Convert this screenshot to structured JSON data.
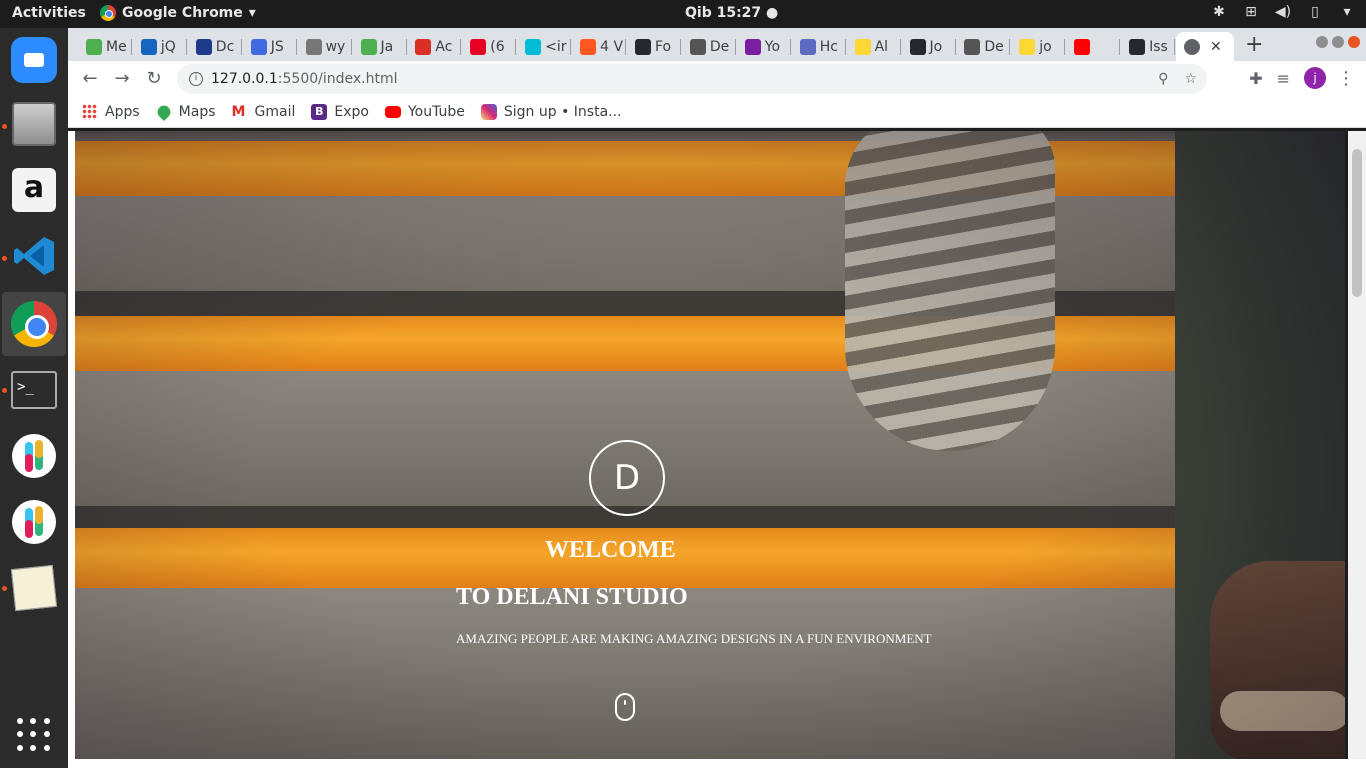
{
  "topbar": {
    "activities": "Activities",
    "app_name": "Google Chrome",
    "clock": "Qib 15:27"
  },
  "dock": {
    "items": [
      "zoom",
      "files",
      "amazon",
      "vscode",
      "chrome",
      "terminal",
      "slack",
      "slack",
      "text-editor"
    ]
  },
  "tabs": [
    {
      "label": "Me",
      "color": "#4caf50"
    },
    {
      "label": "jQ",
      "color": "#1565c0"
    },
    {
      "label": "Dc",
      "color": "#1e3a8a"
    },
    {
      "label": "JS",
      "color": "#4169e1"
    },
    {
      "label": "wy",
      "color": "#777777"
    },
    {
      "label": "Ja",
      "color": "#4caf50"
    },
    {
      "label": "Ac",
      "color": "#d93025"
    },
    {
      "label": "(6",
      "color": "#e60023"
    },
    {
      "label": "<ir",
      "color": "#00bcd4"
    },
    {
      "label": "4 V",
      "color": "#ff5722"
    },
    {
      "label": "Fo",
      "color": "#24292e"
    },
    {
      "label": "De",
      "color": "#555555"
    },
    {
      "label": "Yo",
      "color": "#7b1fa2"
    },
    {
      "label": "Hc",
      "color": "#5c6bc0"
    },
    {
      "label": "Al",
      "color": "#fdd835"
    },
    {
      "label": "Jo",
      "color": "#24292e"
    },
    {
      "label": "De",
      "color": "#555555"
    },
    {
      "label": "jo",
      "color": "#fdd835"
    },
    {
      "label": "",
      "color": "#ff0000"
    },
    {
      "label": "Iss",
      "color": "#24292e"
    }
  ],
  "address_bar": {
    "host": "127.0.0.1",
    "path": ":5500/index.html",
    "avatar_letter": "j"
  },
  "bookmarks": [
    {
      "label": "Apps",
      "icon": "apps-grid-icon",
      "color": "#4285f4"
    },
    {
      "label": "Maps",
      "icon": "maps-icon",
      "color": "#34a853"
    },
    {
      "label": "Gmail",
      "icon": "gmail-icon",
      "color": "#d93025"
    },
    {
      "label": "Expo",
      "icon": "expo-icon",
      "color": "#5b2a86"
    },
    {
      "label": "YouTube",
      "icon": "youtube-icon",
      "color": "#ff0000"
    },
    {
      "label": "Sign up • Insta...",
      "icon": "instagram-icon",
      "color": "#c13584"
    }
  ],
  "hero": {
    "logo_letter": "D",
    "title_line1": "WELCOME",
    "title_line2": "TO DELANI STUDIO",
    "subtitle": "AMAZING PEOPLE ARE MAKING AMAZING DESIGNS IN A FUN ENVIRONMENT"
  }
}
